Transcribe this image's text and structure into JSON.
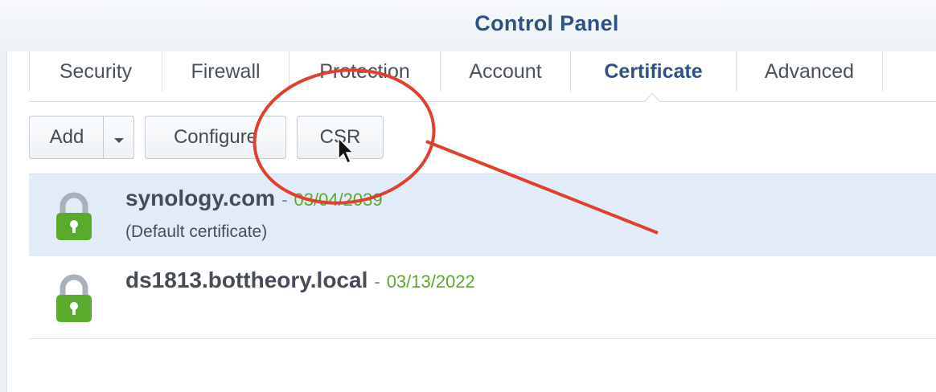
{
  "window": {
    "title": "Control Panel"
  },
  "tabs": [
    {
      "label": "Security"
    },
    {
      "label": "Firewall"
    },
    {
      "label": "Protection"
    },
    {
      "label": "Account"
    },
    {
      "label": "Certificate",
      "active": true
    },
    {
      "label": "Advanced"
    }
  ],
  "toolbar": {
    "add_label": "Add",
    "configure_label": "Configure",
    "csr_label": "CSR"
  },
  "certificates": [
    {
      "name": "synology.com",
      "separator": "-",
      "expiry": "03/04/2039",
      "note": "(Default certificate)",
      "selected": true,
      "icon": "lock-icon"
    },
    {
      "name": "ds1813.bottheory.local",
      "separator": "-",
      "expiry": "03/13/2022",
      "note": "",
      "selected": false,
      "icon": "lock-icon"
    }
  ],
  "colors": {
    "accent": "#2e5286",
    "date_green": "#59a92a",
    "lock_green": "#5aaa2e",
    "selection": "#e2ecf8",
    "annotation_red": "#e0412f"
  }
}
